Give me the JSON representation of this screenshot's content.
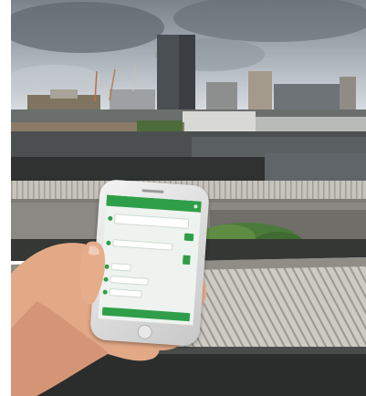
{
  "scene": {
    "description_type": "photograph",
    "subjects": [
      "hand-holding-smartphone",
      "city-skyline",
      "factory-rooftops",
      "cloudy-sky"
    ]
  },
  "colors": {
    "sky_light": "#d6dce2",
    "sky_dark": "#6c737b",
    "roof_light": "#c9c7c0",
    "roof_dark": "#3a3b3a",
    "foliage": "#4b7a3a",
    "skin": "#e8b08f",
    "app_green": "#2f9e48",
    "screen_bg": "#eef3ef"
  },
  "phone": {
    "model": "smartphone",
    "app": {
      "header_icon": "menu-dot-icon",
      "messages": [
        {
          "side": "left",
          "width_frac": 0.78
        },
        {
          "side": "left",
          "width_frac": 0.62
        },
        {
          "side": "left",
          "width_frac": 0.2
        },
        {
          "side": "left",
          "width_frac": 0.38
        },
        {
          "side": "left",
          "width_frac": 0.32
        }
      ],
      "reply_buttons": 2
    }
  }
}
